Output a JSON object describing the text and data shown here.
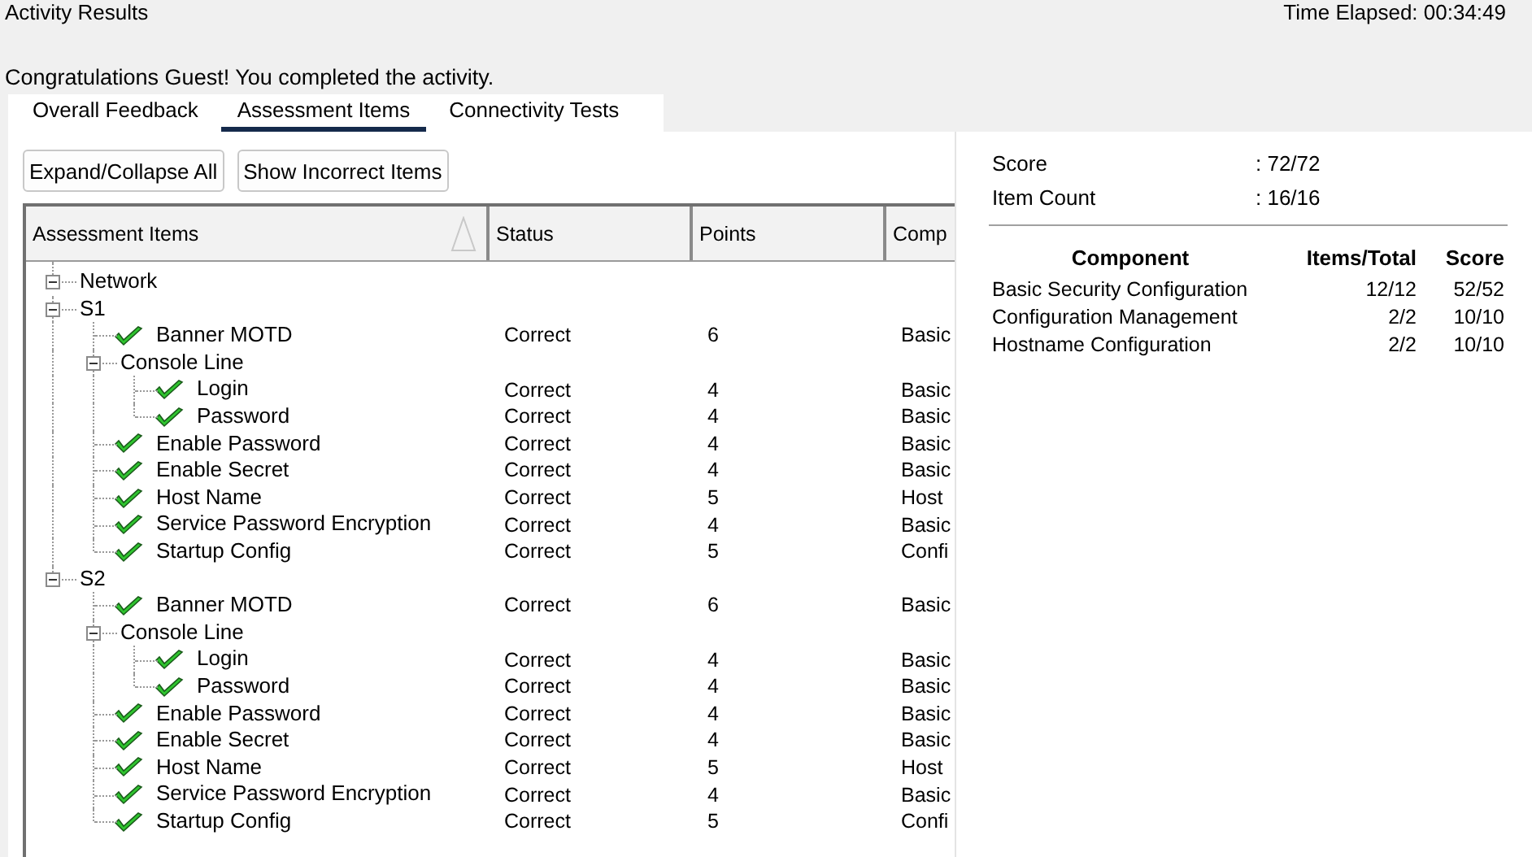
{
  "window": {
    "title": "Activity Results",
    "timer": "Time Elapsed: 00:34:49"
  },
  "message": "Congratulations Guest! You completed the activity.",
  "tabs": [
    {
      "label": "Overall Feedback",
      "selected": false
    },
    {
      "label": "Assessment Items",
      "selected": true
    },
    {
      "label": "Connectivity Tests",
      "selected": false
    }
  ],
  "buttons": [
    "Expand/Collapse All",
    "Show Incorrect Items"
  ],
  "tree": {
    "columns": [
      "Assessment Items",
      "Status",
      "Points",
      "Comp"
    ],
    "root": {
      "kind": "group",
      "label": "Network",
      "expanded": true,
      "children": [
        {
          "kind": "group",
          "label": "S1",
          "expanded": true,
          "children": [
            {
              "kind": "item",
              "label": "Banner MOTD",
              "passed": true,
              "status": "Correct",
              "points": "6",
              "component": "Basic"
            },
            {
              "kind": "group",
              "label": "Console Line",
              "expanded": true,
              "children": [
                {
                  "kind": "item",
                  "label": "Login",
                  "passed": true,
                  "status": "Correct",
                  "points": "4",
                  "component": "Basic"
                },
                {
                  "kind": "item",
                  "label": "Password",
                  "passed": true,
                  "status": "Correct",
                  "points": "4",
                  "component": "Basic"
                }
              ]
            },
            {
              "kind": "item",
              "label": "Enable Password",
              "passed": true,
              "status": "Correct",
              "points": "4",
              "component": "Basic"
            },
            {
              "kind": "item",
              "label": "Enable Secret",
              "passed": true,
              "status": "Correct",
              "points": "4",
              "component": "Basic"
            },
            {
              "kind": "item",
              "label": "Host Name",
              "passed": true,
              "status": "Correct",
              "points": "5",
              "component": "Host"
            },
            {
              "kind": "item",
              "label": "Service Password Encryption",
              "passed": true,
              "status": "Correct",
              "points": "4",
              "component": "Basic"
            },
            {
              "kind": "item",
              "label": "Startup Config",
              "passed": true,
              "status": "Correct",
              "points": "5",
              "component": "Confi"
            }
          ]
        },
        {
          "kind": "group",
          "label": "S2",
          "expanded": true,
          "children": [
            {
              "kind": "item",
              "label": "Banner MOTD",
              "passed": true,
              "status": "Correct",
              "points": "6",
              "component": "Basic"
            },
            {
              "kind": "group",
              "label": "Console Line",
              "expanded": true,
              "children": [
                {
                  "kind": "item",
                  "label": "Login",
                  "passed": true,
                  "status": "Correct",
                  "points": "4",
                  "component": "Basic"
                },
                {
                  "kind": "item",
                  "label": "Password",
                  "passed": true,
                  "status": "Correct",
                  "points": "4",
                  "component": "Basic"
                }
              ]
            },
            {
              "kind": "item",
              "label": "Enable Password",
              "passed": true,
              "status": "Correct",
              "points": "4",
              "component": "Basic"
            },
            {
              "kind": "item",
              "label": "Enable Secret",
              "passed": true,
              "status": "Correct",
              "points": "4",
              "component": "Basic"
            },
            {
              "kind": "item",
              "label": "Host Name",
              "passed": true,
              "status": "Correct",
              "points": "5",
              "component": "Host"
            },
            {
              "kind": "item",
              "label": "Service Password Encryption",
              "passed": true,
              "status": "Correct",
              "points": "4",
              "component": "Basic"
            },
            {
              "kind": "item",
              "label": "Startup Config",
              "passed": true,
              "status": "Correct",
              "points": "5",
              "component": "Confi"
            }
          ]
        }
      ]
    }
  },
  "summary": {
    "stats": [
      {
        "label": "Score",
        "value": ": 72/72"
      },
      {
        "label": "Item Count",
        "value": ": 16/16"
      }
    ],
    "columns": [
      "Component",
      "Items/Total",
      "Score"
    ],
    "rows": [
      {
        "component": "Basic Security Configuration",
        "items": "12/12",
        "score": "52/52"
      },
      {
        "component": "Configuration Management",
        "items": "2/2",
        "score": "10/10"
      },
      {
        "component": "Hostname Configuration",
        "items": "2/2",
        "score": "10/10"
      }
    ]
  }
}
